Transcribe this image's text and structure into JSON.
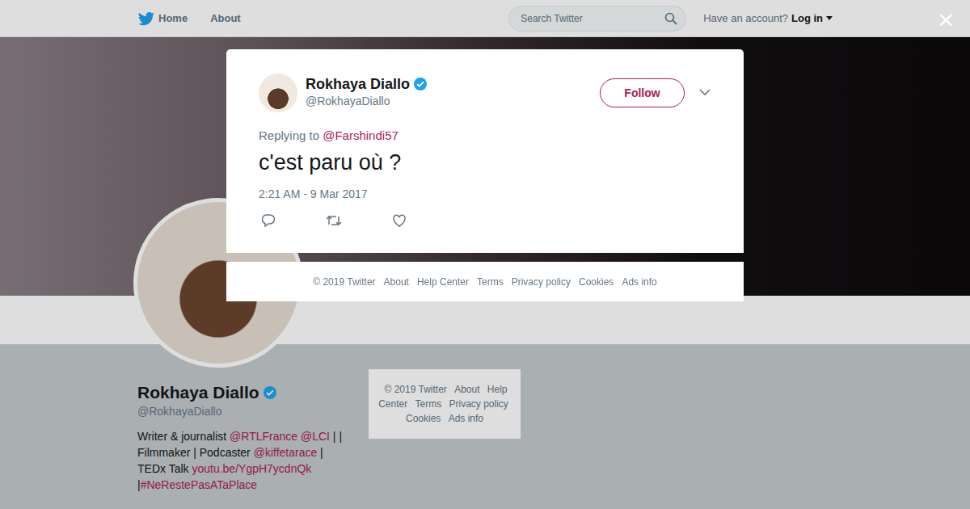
{
  "nav": {
    "home": "Home",
    "about": "About",
    "search_placeholder": "Search Twitter",
    "account_prompt": "Have an account?",
    "login": "Log in"
  },
  "close": "×",
  "tweet": {
    "name": "Rokhaya Diallo",
    "verified": true,
    "handle": "@RokhayaDiallo",
    "follow": "Follow",
    "replying_label": "Replying to",
    "replying_to": "@Farshindi57",
    "text": "c'est paru où ?",
    "time": "2:21 AM - 9 Mar 2017"
  },
  "modal_footer": [
    "© 2019 Twitter",
    "About",
    "Help Center",
    "Terms",
    "Privacy policy",
    "Cookies",
    "Ads info"
  ],
  "profile": {
    "name": "Rokhaya Diallo",
    "verified": true,
    "handle": "@RokhayaDiallo",
    "bio": [
      {
        "text": "Writer & journalist ",
        "kind": "text"
      },
      {
        "text": "@RTLFrance",
        "kind": "link"
      },
      {
        "text": " ",
        "kind": "text"
      },
      {
        "text": "@LCI",
        "kind": "link"
      },
      {
        "text": " | | Filmmaker | Podcaster ",
        "kind": "text"
      },
      {
        "text": "@kiffetarace",
        "kind": "link"
      },
      {
        "text": " | TEDx Talk ",
        "kind": "text"
      },
      {
        "text": "youtu.be/YgpH7ycdnQk",
        "kind": "link"
      },
      {
        "text": " |",
        "kind": "text"
      },
      {
        "text": "#NeRestePasATaPlace",
        "kind": "link"
      }
    ]
  },
  "sidebar_footer": [
    "© 2019 Twitter",
    "About",
    "Help Center",
    "Terms",
    "Privacy policy",
    "Cookies",
    "Ads info"
  ]
}
